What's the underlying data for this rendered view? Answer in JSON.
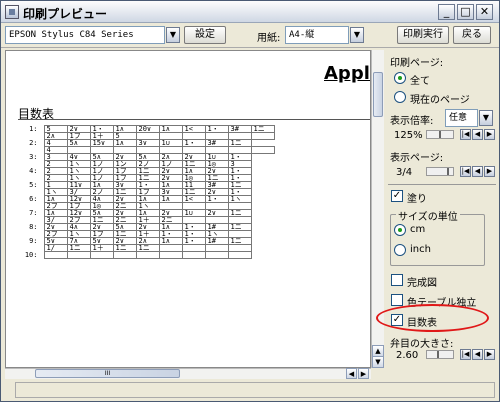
{
  "window": {
    "title": "印刷プレビュー",
    "minimize": "_",
    "maximize": "□",
    "close": "✕"
  },
  "toolbar": {
    "printer": "EPSON Stylus C84 Series",
    "settings_label": "設定",
    "paper_label": "用紙:",
    "paper_value": "A4-縦",
    "print_label": "印刷実行",
    "back_label": "戻る"
  },
  "preview": {
    "header_text": "Apple",
    "table_title": "目数表",
    "rows": [
      [
        "1:",
        "5",
        "2∨",
        "1・",
        "1∧",
        "20∨",
        "1∧",
        "1<",
        "1・",
        "3#",
        "1ニ"
      ],
      [
        "",
        "2∧",
        "1フ",
        "1＋",
        "5",
        "",
        "",
        "",
        "",
        "",
        ""
      ],
      [
        "2:",
        "4",
        "5∧",
        "15∨",
        "1∧",
        "3∨",
        "1∪",
        "1・",
        "3#",
        "1ニ"
      ],
      [
        "",
        "4",
        "",
        "",
        "",
        "",
        "",
        "",
        "",
        "",
        ""
      ],
      [
        "3:",
        "3",
        "4∨",
        "5∧",
        "2∨",
        "5∧",
        "2∧",
        "2∨",
        "1∪",
        "1・"
      ],
      [
        "",
        "2",
        "1ヽ",
        "1ノ",
        "1ン",
        "2ノ",
        "1ノ",
        "1ニ",
        "1◎",
        "3"
      ],
      [
        "4:",
        "2",
        "1ヽ",
        "1ノ",
        "1フ",
        "1ニ",
        "2∨",
        "1∧",
        "2∨",
        "1・"
      ],
      [
        "",
        "2",
        "1ヽ",
        "1ノ",
        "1フ",
        "1ニ",
        "2∨",
        "1◎",
        "1ニ",
        "1・"
      ],
      [
        "5:",
        "1",
        "11∨",
        "1∧",
        "3∨",
        "1・",
        "1∧",
        "11",
        "3#",
        "1ニ"
      ],
      [
        "",
        "1ヽ",
        "3/",
        "2ノ",
        "1ニ",
        "1フ",
        "3∨",
        "1ニ",
        "2∨",
        "1・"
      ],
      [
        "6:",
        "1∧",
        "12∨",
        "4∧",
        "2∨",
        "1∧",
        "1∧",
        "1<",
        "1・",
        "1ヽ"
      ],
      [
        "",
        "2フ",
        "1フ",
        "1◎",
        "2ニ",
        "1ヽ",
        "",
        "",
        "",
        ""
      ],
      [
        "7:",
        "1∧",
        "12∨",
        "5∧",
        "2∨",
        "1∧",
        "2∨",
        "1∪",
        "2∨",
        "1ニ"
      ],
      [
        "",
        "3/",
        "2フ",
        "1ニ",
        "2ニ",
        "1＋",
        "2ニ",
        "",
        "",
        ""
      ],
      [
        "8:",
        "2∨",
        "4∧",
        "2∨",
        "5∧",
        "2∨",
        "1∧",
        "1・",
        "1#",
        "1ニ"
      ],
      [
        "",
        "2フ",
        "1ヽ",
        "1フ",
        "1ニ",
        "1＋",
        "1・",
        "1・",
        "1ヽ",
        ""
      ],
      [
        "9:",
        "5∨",
        "7∧",
        "5∨",
        "2∨",
        "2∧",
        "1∧",
        "1・",
        "1#",
        "1ニ"
      ],
      [
        "",
        "1/",
        "1ニ",
        "1＋",
        "1ニ",
        "1ニ",
        "",
        "",
        "",
        ""
      ],
      [
        "10:",
        "",
        "",
        "",
        "",
        "",
        "",
        "",
        "",
        ""
      ]
    ]
  },
  "panel": {
    "print_pages_label": "印刷ページ:",
    "all_label": "全て",
    "current_page_label": "現在のページ",
    "zoom_label": "表示倍率:",
    "zoom_mode": "任意",
    "zoom_value": "125%",
    "display_page_label": "表示ページ:",
    "page_value": "3/4",
    "fill_label": "塗り",
    "size_unit_label": "サイズの単位",
    "cm_label": "cm",
    "inch_label": "inch",
    "complete_label": "完成図",
    "color_table_label": "色テーブル独立",
    "stitch_table_label": "目数表",
    "bullet_size_label": "弁目の大きさ:",
    "bullet_size_value": "2.60"
  },
  "statusbar": {
    "text": ""
  },
  "colors": {
    "highlight_circle": "#e01818",
    "radio_dot": "#1c9c1c"
  }
}
